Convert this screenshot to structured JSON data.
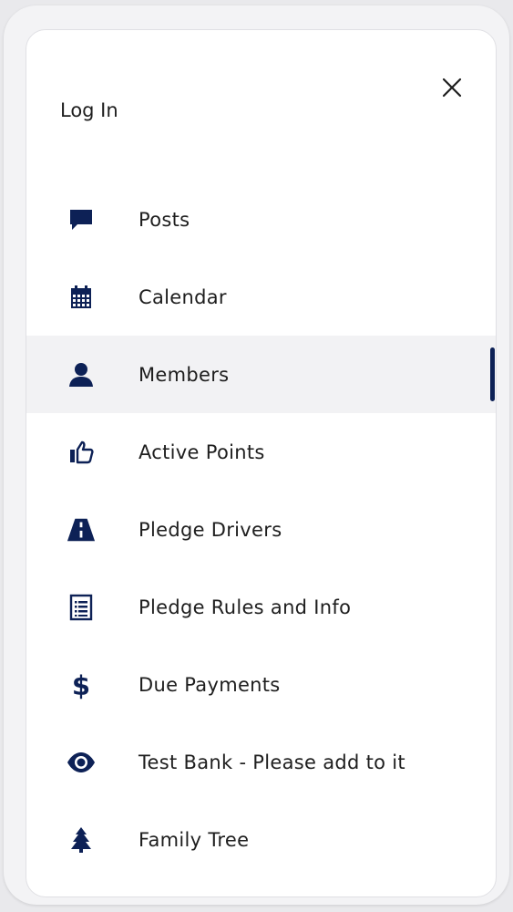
{
  "header": {
    "login_label": "Log In"
  },
  "colors": {
    "icon": "#0d2156",
    "text": "#1e1e1e",
    "active_bg": "#f2f2f4",
    "active_indicator": "#0d2156"
  },
  "menu": {
    "items": [
      {
        "label": "Posts",
        "icon": "chat-bubble-icon",
        "active": false
      },
      {
        "label": "Calendar",
        "icon": "calendar-icon",
        "active": false
      },
      {
        "label": "Members",
        "icon": "person-icon",
        "active": true
      },
      {
        "label": "Active Points",
        "icon": "thumbs-up-icon",
        "active": false
      },
      {
        "label": "Pledge Drivers",
        "icon": "road-icon",
        "active": false
      },
      {
        "label": "Pledge Rules and Info",
        "icon": "list-document-icon",
        "active": false
      },
      {
        "label": "Due Payments",
        "icon": "dollar-icon",
        "active": false
      },
      {
        "label": "Test Bank - Please add to it",
        "icon": "eye-icon",
        "active": false
      },
      {
        "label": "Family Tree",
        "icon": "tree-icon",
        "active": false
      }
    ]
  }
}
